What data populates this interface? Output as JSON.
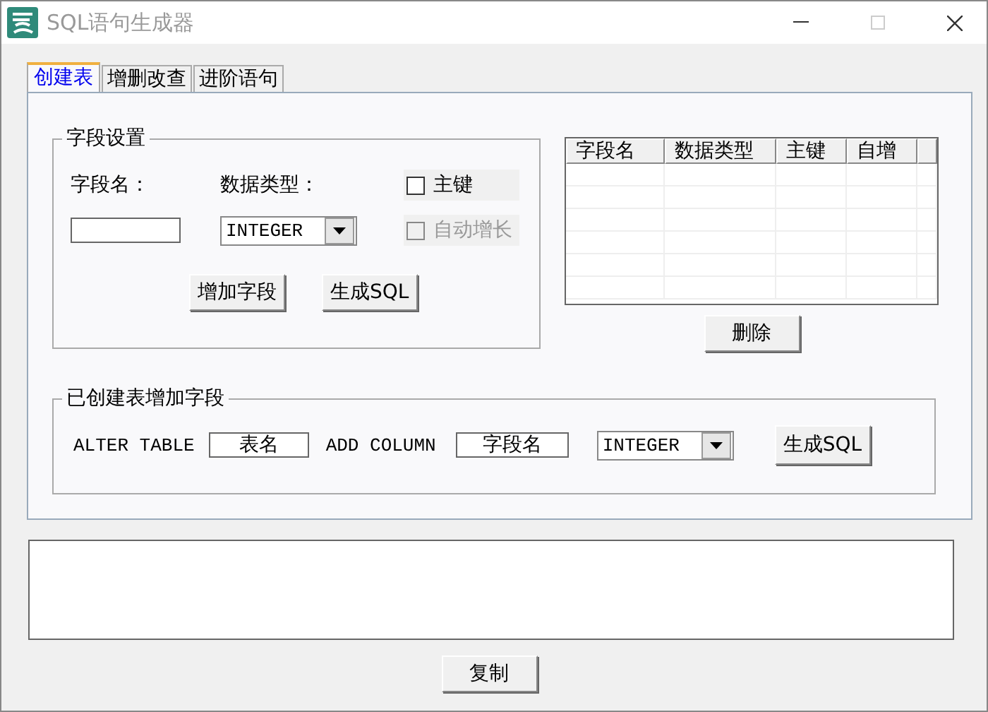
{
  "window": {
    "title": "SQL语句生成器"
  },
  "tabs": [
    {
      "label": "创建表",
      "selected": true
    },
    {
      "label": "增删改查",
      "selected": false
    },
    {
      "label": "进阶语句",
      "selected": false
    }
  ],
  "field_settings": {
    "title": "字段设置",
    "name_label": "字段名：",
    "type_label": "数据类型：",
    "type_select": {
      "value": "INTEGER"
    },
    "checkboxes": [
      {
        "label": "主键",
        "checked": false,
        "disabled": false
      },
      {
        "label": "自动增长",
        "checked": false,
        "disabled": true
      }
    ],
    "buttons": [
      "增加字段",
      "生成SQL"
    ]
  },
  "field_table": {
    "columns": [
      "字段名",
      "数据类型",
      "主键",
      "自增"
    ]
  },
  "delete_button": "删除",
  "alter_table": {
    "title": "已创建表增加字段",
    "prefix": "ALTER TABLE",
    "table_name_field": {
      "value": "表名"
    },
    "middle": "ADD COLUMN",
    "column_field": {
      "value": "字段名"
    },
    "type_select": {
      "value": "INTEGER"
    },
    "button": "生成SQL"
  },
  "copy_button": "复制"
}
